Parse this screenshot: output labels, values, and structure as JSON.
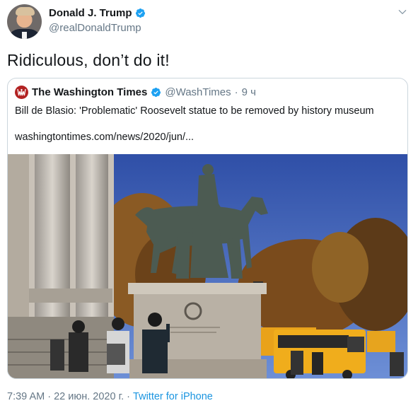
{
  "author": {
    "display_name": "Donald J. Trump",
    "handle": "@realDonaldTrump",
    "verified": true
  },
  "tweet": {
    "text": "Ridiculous, don’t do it!"
  },
  "quoted": {
    "display_name": "The Washington Times",
    "handle": "@WashTimes",
    "separator": "·",
    "time": "9 ч",
    "verified": true,
    "text": "Bill de Blasio: 'Problematic' Roosevelt statue to be removed by history museum",
    "link": "washingtontimes.com/news/2020/jun/..."
  },
  "meta": {
    "time": "7:39 AM",
    "separator": "·",
    "date": "22 июн. 2020 г.",
    "source": "Twitter for iPhone"
  },
  "icons": {
    "verified": "verified-badge-icon",
    "more": "chevron-down-icon",
    "publisher_logo": "washington-times-logo"
  },
  "colors": {
    "verified": "#1da1f2",
    "link": "#1b95e0",
    "muted": "#657786",
    "border": "#ccd6dd"
  }
}
